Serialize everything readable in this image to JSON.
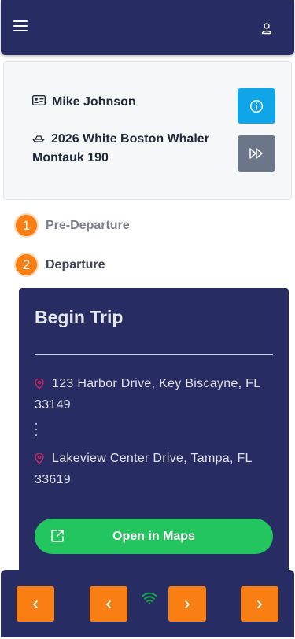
{
  "header": {
    "menu_icon": "hamburger-menu-icon",
    "user_icon": "user-icon"
  },
  "info_card": {
    "driver_icon": "id-card-icon",
    "driver_name": "Mike Johnson",
    "boat_icon": "boat-icon",
    "boat_name": "2026 White Boston Whaler Montauk 190",
    "info_button_icon": "info-icon",
    "skip_button_icon": "fast-forward-icon",
    "colors": {
      "info": "#0ea5e9",
      "skip": "#6b7688"
    }
  },
  "steps": [
    {
      "number": "1",
      "label": "Pre-Departure"
    },
    {
      "number": "2",
      "label": "Departure"
    }
  ],
  "trip": {
    "title": "Begin Trip",
    "from_address": "123 Harbor Drive, Key Biscayne, FL 33149",
    "to_address": "Lakeview Center Drive, Tampa, FL 33619",
    "pin_icon": "map-pin-icon",
    "open_maps_label": "Open in Maps",
    "open_maps_icon": "external-link-icon"
  },
  "footer": {
    "buttons": [
      "first-page-icon",
      "previous-icon",
      "next-icon",
      "last-page-icon"
    ],
    "status_icon": "wifi-icon",
    "status_color": "#16a34a"
  },
  "theme": {
    "navy": "#272d63",
    "accent_orange": "#f97e14",
    "success_green": "#22c55e"
  }
}
